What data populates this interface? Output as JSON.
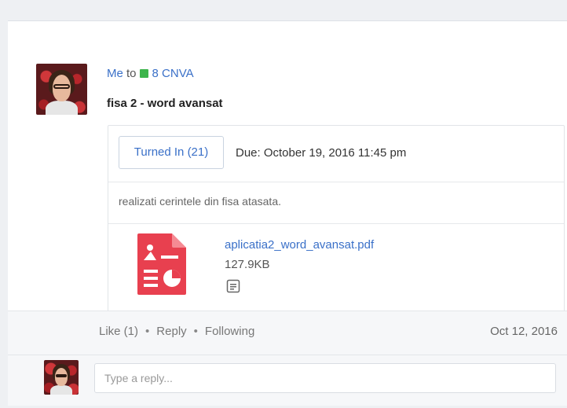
{
  "post": {
    "author": "Me",
    "to_word": "to",
    "group": "8 CNVA",
    "group_color": "#3cb44b",
    "title": "fisa 2 - word avansat",
    "turned_in_label": "Turned In (21)",
    "due": "Due: October 19, 2016 11:45 pm",
    "description": "realizati cerintele din fisa atasata.",
    "attachment": {
      "name": "aplicatia2_word_avansat.pdf",
      "size": "127.9KB",
      "icon": "pdf-file-icon",
      "icon_color": "#e8404f"
    }
  },
  "footer": {
    "like": "Like (1)",
    "reply": "Reply",
    "following": "Following",
    "separator": "•",
    "date": "Oct 12, 2016"
  },
  "reply_box": {
    "placeholder": "Type a reply..."
  },
  "colors": {
    "link": "#3a70c8"
  }
}
